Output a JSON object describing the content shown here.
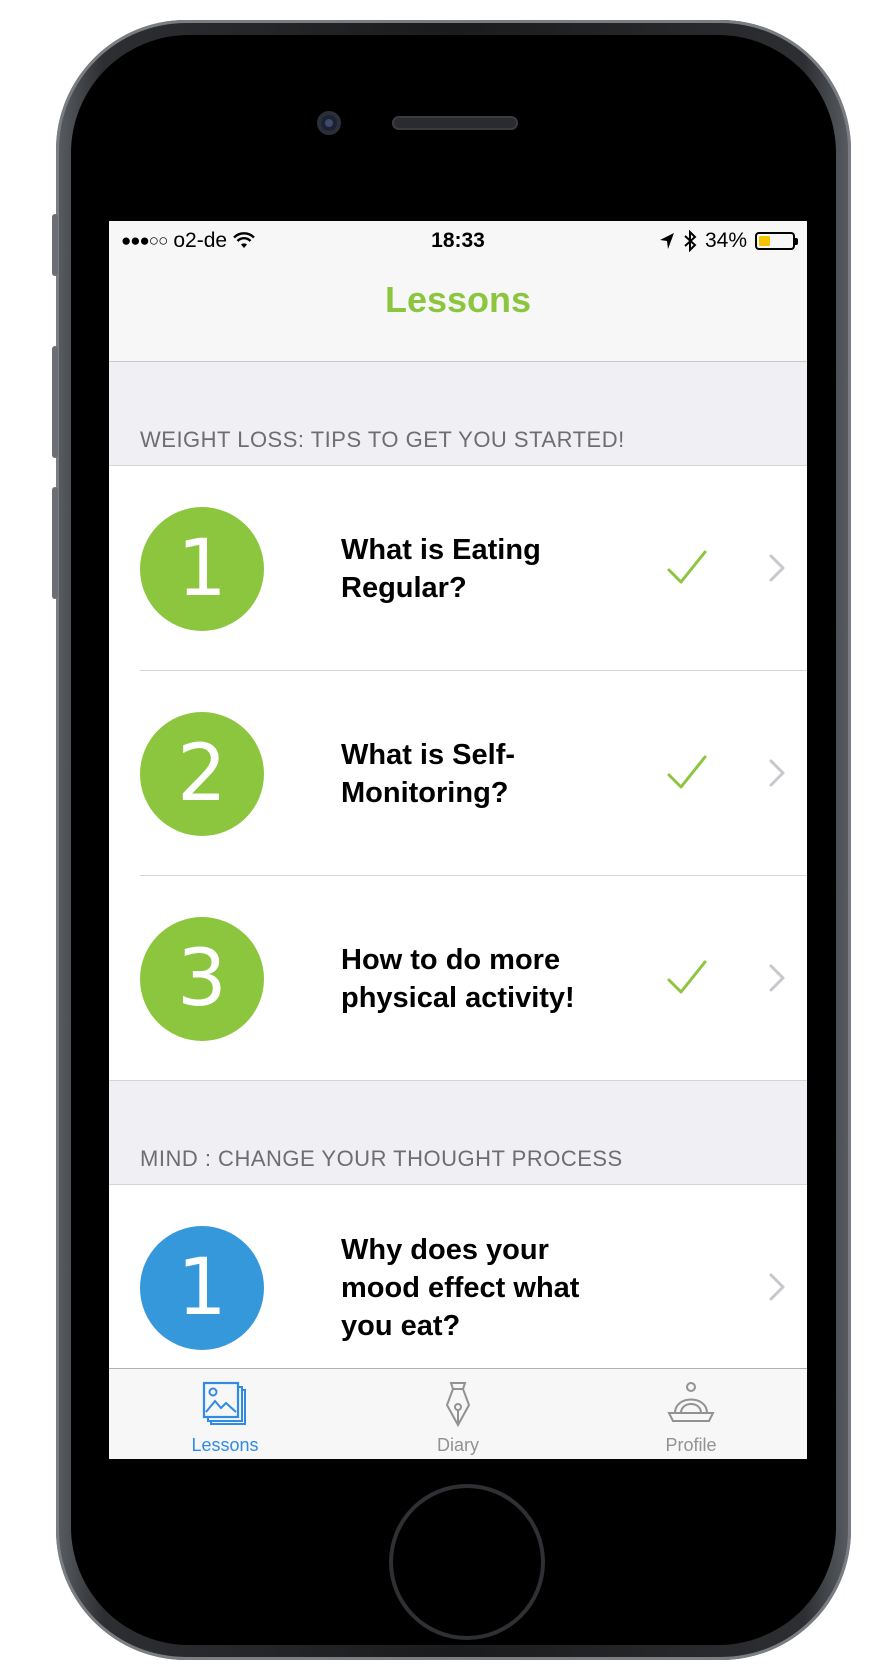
{
  "status_bar": {
    "signal": "●●●○○",
    "carrier": "o2-de",
    "time": "18:33",
    "battery_percent": "34%",
    "battery_level": 0.34,
    "icons": [
      "wifi-icon",
      "location-arrow-icon",
      "bluetooth-icon",
      "battery-icon"
    ]
  },
  "nav": {
    "title": "Lessons"
  },
  "sections": [
    {
      "header": "WEIGHT LOSS: TIPS TO GET YOU STARTED!",
      "lessons": [
        {
          "number": "1",
          "title": "What is Eating Regular?",
          "completed": true,
          "color": "#8cc63f"
        },
        {
          "number": "2",
          "title": "What is Self-Monitoring?",
          "completed": true,
          "color": "#8cc63f"
        },
        {
          "number": "3",
          "title": "How to do more physical activity!",
          "completed": true,
          "color": "#8cc63f"
        }
      ]
    },
    {
      "header": "MIND : CHANGE YOUR THOUGHT PROCESS",
      "lessons": [
        {
          "number": "1",
          "title": "Why does your mood effect what you eat?",
          "completed": false,
          "color": "#3598db"
        }
      ]
    }
  ],
  "tab_bar": {
    "tabs": [
      {
        "label": "Lessons",
        "icon": "lessons-images-icon",
        "active": true
      },
      {
        "label": "Diary",
        "icon": "pen-nib-icon",
        "active": false
      },
      {
        "label": "Profile",
        "icon": "crown-icon",
        "active": false
      }
    ]
  },
  "colors": {
    "accent_green": "#8cc63f",
    "accent_blue": "#3598db",
    "tab_active": "#2f8be6"
  }
}
